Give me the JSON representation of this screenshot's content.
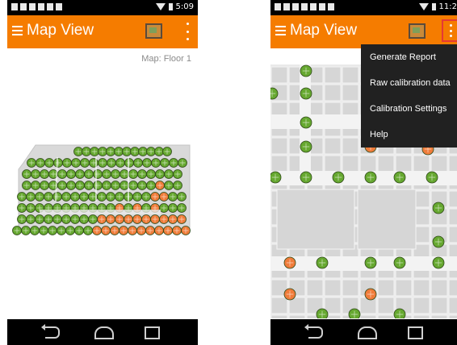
{
  "left_screen": {
    "status_time": "5:09",
    "app_title": "Map View",
    "map_label": "Map: Floor 1"
  },
  "right_screen": {
    "status_time": "11:2",
    "app_title": "Map View",
    "menu_items": [
      "Generate Report",
      "Raw calibration data",
      "Calibration Settings",
      "Help"
    ]
  },
  "icons": {
    "menu": "hamburger-icon",
    "map_toggle": "map-icon",
    "overflow": "more-vert-icon",
    "nav": [
      "back-icon",
      "home-icon",
      "recent-apps-icon"
    ]
  },
  "colors": {
    "app_bar": "#f57c00",
    "calibrated_point": "#66a830",
    "uncalibrated_point": "#f07c3a",
    "menu_background": "#212121",
    "highlight_border": "#e53935"
  }
}
